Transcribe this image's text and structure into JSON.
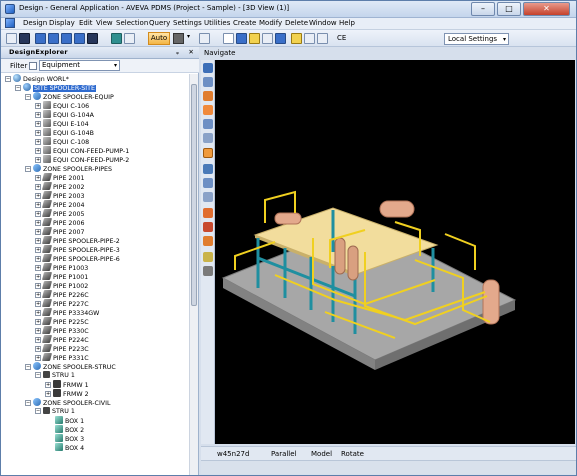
{
  "window": {
    "title": "Design - General Application - AVEVA PDMS (Project - Sample) - [3D View (1)]",
    "minimize": "–",
    "maximize": "□",
    "close": "✕"
  },
  "menu": [
    "Design",
    "Display",
    "Edit",
    "View",
    "Selection",
    "Query",
    "Settings",
    "Utilities",
    "Create",
    "Modify",
    "Delete",
    "Window",
    "Help"
  ],
  "toolbar": {
    "auto_label": "Auto",
    "ce_label": "CE",
    "settings_select": "Local Settings",
    "swatch_color": "#666666"
  },
  "explorer": {
    "title": "DesignExplorer",
    "pin": "ᵩ",
    "close": "✕",
    "filter_label": "Filter",
    "filter_value": "Equipment",
    "tree": [
      {
        "label": "Design WORL*",
        "icon": "world",
        "expander": "−",
        "indent": 0
      },
      {
        "label": "SITE SPOOLER-SITE",
        "icon": "site",
        "expander": "−",
        "indent": 1,
        "selected": true
      },
      {
        "label": "ZONE SPOOLER-EQUIP",
        "icon": "zone",
        "expander": "−",
        "indent": 2
      },
      {
        "label": "EQUI C-106",
        "icon": "equi",
        "expander": "+",
        "indent": 3
      },
      {
        "label": "EQUI G-104A",
        "icon": "equi",
        "expander": "+",
        "indent": 3
      },
      {
        "label": "EQUI E-104",
        "icon": "equi",
        "expander": "+",
        "indent": 3
      },
      {
        "label": "EQUI G-104B",
        "icon": "equi",
        "expander": "+",
        "indent": 3
      },
      {
        "label": "EQUI C-108",
        "icon": "equi",
        "expander": "+",
        "indent": 3
      },
      {
        "label": "EQUI CON-FEED-PUMP-1",
        "icon": "equi",
        "expander": "+",
        "indent": 3
      },
      {
        "label": "EQUI CON-FEED-PUMP-2",
        "icon": "equi",
        "expander": "+",
        "indent": 3
      },
      {
        "label": "ZONE SPOOLER-PIPES",
        "icon": "zone",
        "expander": "−",
        "indent": 2
      },
      {
        "label": "PIPE 2001",
        "icon": "pipe",
        "expander": "+",
        "indent": 3
      },
      {
        "label": "PIPE 2002",
        "icon": "pipe",
        "expander": "+",
        "indent": 3
      },
      {
        "label": "PIPE 2003",
        "icon": "pipe",
        "expander": "+",
        "indent": 3
      },
      {
        "label": "PIPE 2004",
        "icon": "pipe",
        "expander": "+",
        "indent": 3
      },
      {
        "label": "PIPE 2005",
        "icon": "pipe",
        "expander": "+",
        "indent": 3
      },
      {
        "label": "PIPE 2006",
        "icon": "pipe",
        "expander": "+",
        "indent": 3
      },
      {
        "label": "PIPE 2007",
        "icon": "pipe",
        "expander": "+",
        "indent": 3
      },
      {
        "label": "PIPE SPOOLER-PIPE-2",
        "icon": "pipe",
        "expander": "+",
        "indent": 3
      },
      {
        "label": "PIPE SPOOLER-PIPE-3",
        "icon": "pipe",
        "expander": "+",
        "indent": 3
      },
      {
        "label": "PIPE SPOOLER-PIPE-6",
        "icon": "pipe",
        "expander": "+",
        "indent": 3
      },
      {
        "label": "PIPE P1003",
        "icon": "pipe",
        "expander": "+",
        "indent": 3
      },
      {
        "label": "PIPE P1001",
        "icon": "pipe",
        "expander": "+",
        "indent": 3
      },
      {
        "label": "PIPE P1002",
        "icon": "pipe",
        "expander": "+",
        "indent": 3
      },
      {
        "label": "PIPE P226C",
        "icon": "pipe",
        "expander": "+",
        "indent": 3
      },
      {
        "label": "PIPE P227C",
        "icon": "pipe",
        "expander": "+",
        "indent": 3
      },
      {
        "label": "PIPE P3334GW",
        "icon": "pipe",
        "expander": "+",
        "indent": 3
      },
      {
        "label": "PIPE P225C",
        "icon": "pipe",
        "expander": "+",
        "indent": 3
      },
      {
        "label": "PIPE P330C",
        "icon": "pipe",
        "expander": "+",
        "indent": 3
      },
      {
        "label": "PIPE P224C",
        "icon": "pipe",
        "expander": "+",
        "indent": 3
      },
      {
        "label": "PIPE P223C",
        "icon": "pipe",
        "expander": "+",
        "indent": 3
      },
      {
        "label": "PIPE P331C",
        "icon": "pipe",
        "expander": "+",
        "indent": 3
      },
      {
        "label": "ZONE SPOOLER-STRUC",
        "icon": "zone",
        "expander": "−",
        "indent": 2
      },
      {
        "label": "STRU 1",
        "icon": "stru",
        "expander": "−",
        "indent": 3
      },
      {
        "label": "FRMW 1",
        "icon": "frmw",
        "expander": "+",
        "indent": 4
      },
      {
        "label": "FRMW 2",
        "icon": "frmw",
        "expander": "+",
        "indent": 4
      },
      {
        "label": "ZONE SPOOLER-CIVIL",
        "icon": "zone",
        "expander": "−",
        "indent": 2
      },
      {
        "label": "STRU 1",
        "icon": "stru",
        "expander": "−",
        "indent": 3
      },
      {
        "label": "BOX 1",
        "icon": "box",
        "expander": "",
        "indent": 4
      },
      {
        "label": "BOX 2",
        "icon": "box",
        "expander": "",
        "indent": 4
      },
      {
        "label": "BOX 3",
        "icon": "box",
        "expander": "",
        "indent": 4
      },
      {
        "label": "BOX 4",
        "icon": "box",
        "expander": "",
        "indent": 4
      }
    ]
  },
  "view": {
    "navigate_label": "Navigate",
    "status": {
      "direction": "w45n27d",
      "projection": "Parallel",
      "mode": "Model",
      "action": "Rotate"
    }
  },
  "colors": {
    "structure": "#1f8fa0",
    "pipe": "#f0d020",
    "equipment": "#e3a98c",
    "platform": "#f2dd9d",
    "ground": "#9a9a9a",
    "selection": "#2f6bcf",
    "viewport_bg": "#000000"
  }
}
